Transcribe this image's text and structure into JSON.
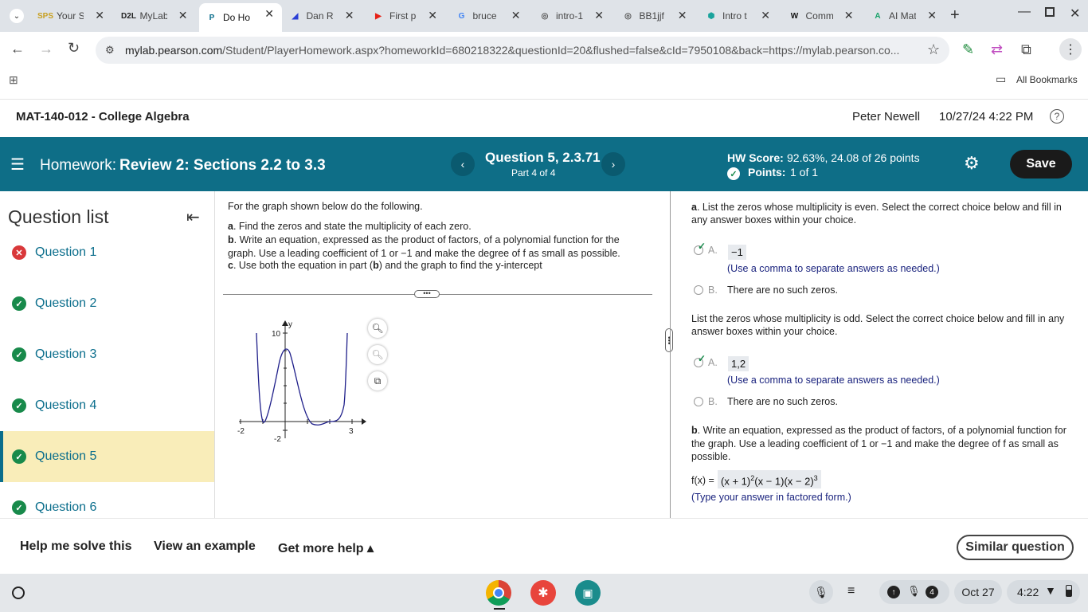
{
  "browser": {
    "tabs": [
      {
        "title": "Your S",
        "fav": "SPS",
        "fav_color": "#c8a020"
      },
      {
        "title": "MyLab",
        "fav": "D2L",
        "fav_color": "#222"
      },
      {
        "title": "Do Ho",
        "fav": "P",
        "fav_color": "#0b6e8c"
      },
      {
        "title": "Dan R",
        "fav": "◢",
        "fav_color": "#2b3fd6"
      },
      {
        "title": "First p",
        "fav": "▶",
        "fav_color": "#e62117"
      },
      {
        "title": "bruce",
        "fav": "G",
        "fav_color": "#4285f4"
      },
      {
        "title": "intro-1",
        "fav": "◎",
        "fav_color": "#555"
      },
      {
        "title": "BB1jjf",
        "fav": "◎",
        "fav_color": "#555"
      },
      {
        "title": "Intro t",
        "fav": "⬢",
        "fav_color": "#1aa39c"
      },
      {
        "title": "Comm",
        "fav": "W",
        "fav_color": "#111"
      },
      {
        "title": "AI Mat",
        "fav": "A",
        "fav_color": "#1aa36b"
      }
    ],
    "url_host": "mylab.pearson.com",
    "url_rest": "/Student/PlayerHomework.aspx?homeworkId=680218322&questionId=20&flushed=false&cId=7950108&back=https://mylab.pearson.co...",
    "bookmarks_label": "All Bookmarks"
  },
  "app": {
    "course": "MAT-140-012 - College Algebra",
    "user": "Peter Newell",
    "datetime": "10/27/24 4:22 PM",
    "homework_prefix": "Homework:",
    "homework_title": "Review 2: Sections 2.2 to 3.3",
    "question_title": "Question 5, 2.3.71",
    "question_part": "Part 4 of 4",
    "hw_score_label": "HW Score:",
    "hw_score_value": "92.63%, 24.08 of 26 points",
    "points_label": "Points:",
    "points_value": "1 of 1",
    "save_label": "Save"
  },
  "sidebar": {
    "title": "Question list",
    "questions": [
      {
        "label": "Question 1",
        "status": "wrong"
      },
      {
        "label": "Question 2",
        "status": "correct"
      },
      {
        "label": "Question 3",
        "status": "correct"
      },
      {
        "label": "Question 4",
        "status": "correct"
      },
      {
        "label": "Question 5",
        "status": "correct"
      },
      {
        "label": "Question 6",
        "status": "correct"
      }
    ]
  },
  "question": {
    "intro": "For the graph shown below do the following.",
    "a_letter": "a",
    "a_text": ". Find the zeros and state the multiplicity of each zero.",
    "b_letter": "b",
    "b_text": ". Write an equation, expressed as the product of factors, of a polynomial function for the graph. Use a leading coefficient of 1 or −1 and make the degree of f as small as possible.",
    "c_letter": "c",
    "c_text_1": ". Use both the equation in part (",
    "c_bold": "b",
    "c_text_2": ") and the graph to find the y-intercept",
    "graph_labels": {
      "y": "y",
      "y_top": "10",
      "y_bottom": "-2",
      "x_left": "-2",
      "x_right": "3"
    }
  },
  "answer": {
    "a_letter": "a",
    "a_prompt": ". List the zeros whose multiplicity is even. Select the correct choice below and fill in any answer boxes within your choice.",
    "choice_a": "A.",
    "even_value": "−1",
    "comma_hint": "(Use a comma to separate answers as needed.)",
    "choice_b": "B.",
    "no_zeros": "There are no such zeros.",
    "odd_prompt": "List the zeros whose multiplicity is odd. Select the correct choice below and fill in any answer boxes within your choice.",
    "odd_value": "1,2",
    "b_letter": "b",
    "b_prompt": ". Write an equation, expressed as the product of factors, of a polynomial function for the graph. Use a leading coefficient of 1 or −1 and make the degree of f as small as possible.",
    "fx_label": "f(x) =",
    "eq_p1": "(x + 1)",
    "eq_exp1": "2",
    "eq_p2": "(x − 1)(x − 2)",
    "eq_exp2": "3",
    "factored_hint": "(Type your answer in factored form.)"
  },
  "footer": {
    "help": "Help me solve this",
    "example": "View an example",
    "more": "Get more help ▴",
    "similar": "Similar question"
  },
  "shelf": {
    "date": "Oct 27",
    "time": "4:22",
    "notif": "4"
  }
}
